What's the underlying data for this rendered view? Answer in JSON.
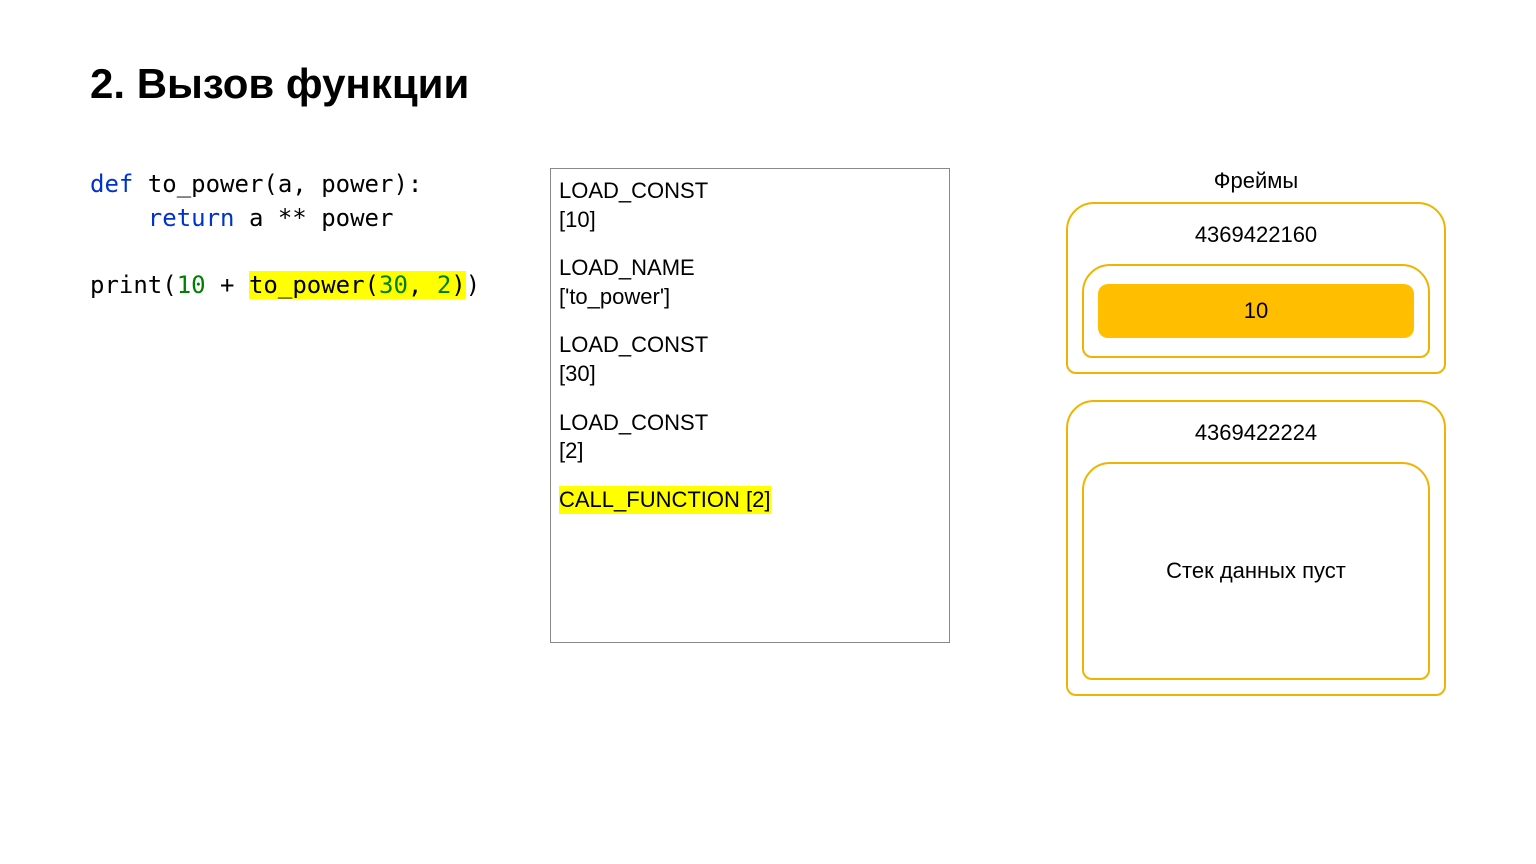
{
  "title": "2. Вызов функции",
  "code": {
    "line1": {
      "def": "def",
      "rest": " to_power(a, power):"
    },
    "line2": {
      "indent": "    ",
      "return": "return",
      "rest": " a ** power"
    },
    "line3": {
      "pre": "print(",
      "num1": "10",
      "mid": " + ",
      "call_name": "to_power(",
      "arg1": "30",
      "comma": ", ",
      "arg2": "2",
      "close": ")",
      "outer_close": ")"
    }
  },
  "bytecode": [
    {
      "op": "LOAD_CONST",
      "arg": "[10]",
      "hl": false
    },
    {
      "op": "LOAD_NAME",
      "arg": "['to_power']",
      "hl": false
    },
    {
      "op": "LOAD_CONST",
      "arg": "[30]",
      "hl": false
    },
    {
      "op": "LOAD_CONST",
      "arg": "[2]",
      "hl": false
    },
    {
      "op": "CALL_FUNCTION [2]",
      "arg": "",
      "hl": true
    }
  ],
  "frames_label": "Фреймы",
  "frames": [
    {
      "id": "4369422160",
      "stack": [
        "10"
      ],
      "empty_text": ""
    },
    {
      "id": "4369422224",
      "stack": [],
      "empty_text": "Стек данных пуст"
    }
  ]
}
